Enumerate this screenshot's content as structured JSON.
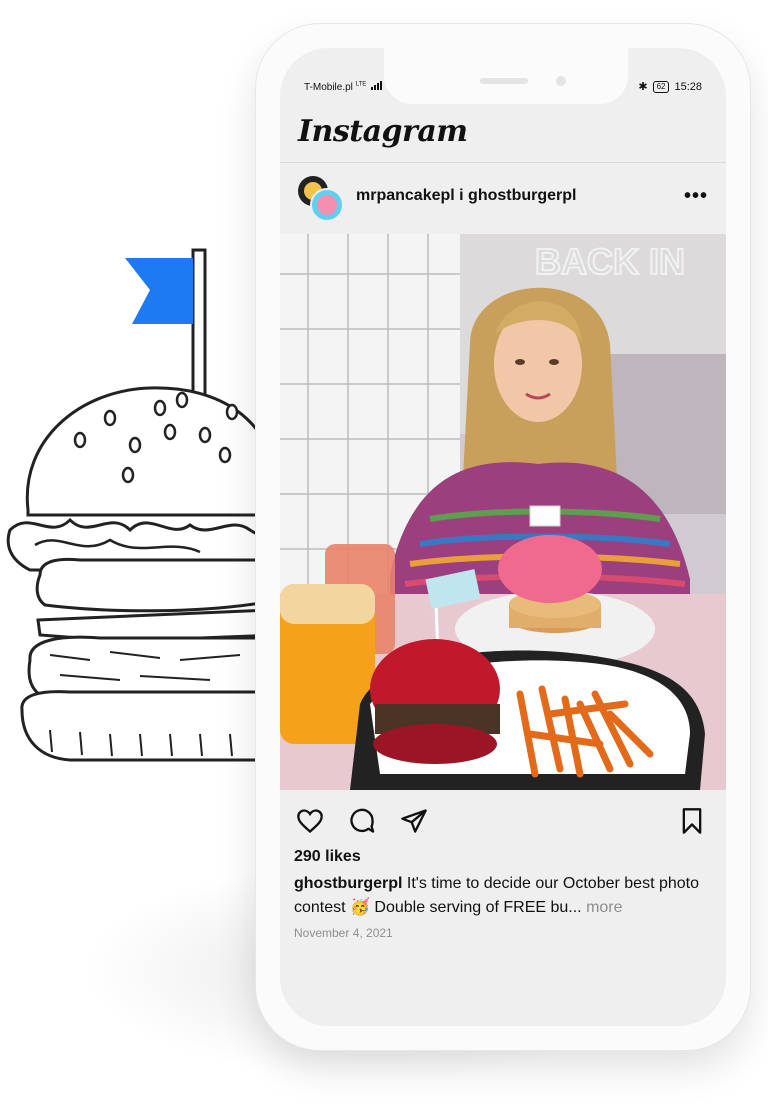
{
  "status_bar": {
    "carrier": "T-Mobile.pl",
    "network": "LTE",
    "battery": "62",
    "time": "15:28"
  },
  "app": {
    "name": "Instagram"
  },
  "post": {
    "header": {
      "usernames": "mrpancakepl i ghostburgerpl",
      "more_label": "•••"
    },
    "photo": {
      "sign_text": "BACK IN"
    },
    "likes": "290 likes",
    "caption": {
      "username": "ghostburgerpl",
      "text": "It's time to decide our October best photo contest 🥳 Double serving of FREE bu...",
      "more": "more"
    },
    "date": "November 4, 2021"
  },
  "icons": {
    "like": "heart-icon",
    "comment": "comment-icon",
    "share": "send-icon",
    "save": "bookmark-icon",
    "more": "more-dots-icon"
  },
  "colors": {
    "flag": "#1e7af2",
    "burger_bun": "#c2182c",
    "cotton_candy": "#f06a8f",
    "fries": "#e36a1a",
    "juice": "#f6a11a"
  }
}
